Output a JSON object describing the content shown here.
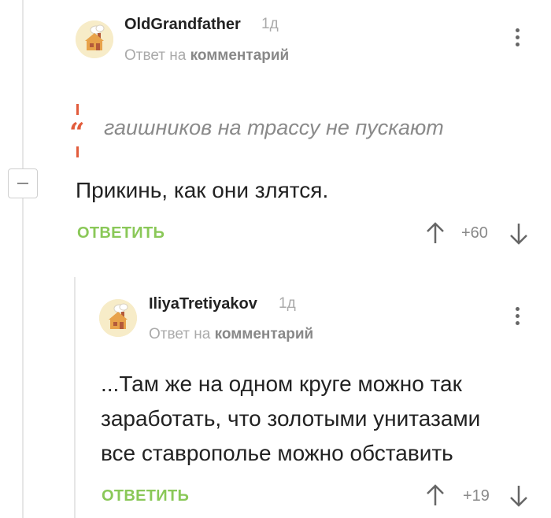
{
  "comment1": {
    "username": "OldGrandfather",
    "time": "1д",
    "reply_prefix": "Ответ на",
    "reply_target": "комментарий",
    "quote": "гаишников на трассу не пускают",
    "body": "Прикинь, как они злятся.",
    "reply_label": "ОТВЕТИТЬ",
    "rating": "+60"
  },
  "comment2": {
    "username": "IliyaTretiyakov",
    "time": "1д",
    "reply_prefix": "Ответ на",
    "reply_target": "комментарий",
    "body_lines": [
      "...Там же на одном круге можно так",
      "заработать, что золотыми унитазами",
      "все ставрополье можно обставить"
    ],
    "reply_label": "ОТВЕТИТЬ",
    "rating": "+19"
  },
  "colors": {
    "accent_green": "#8ac858",
    "quote_red": "#e25c3c",
    "muted": "#aaaaaa"
  }
}
